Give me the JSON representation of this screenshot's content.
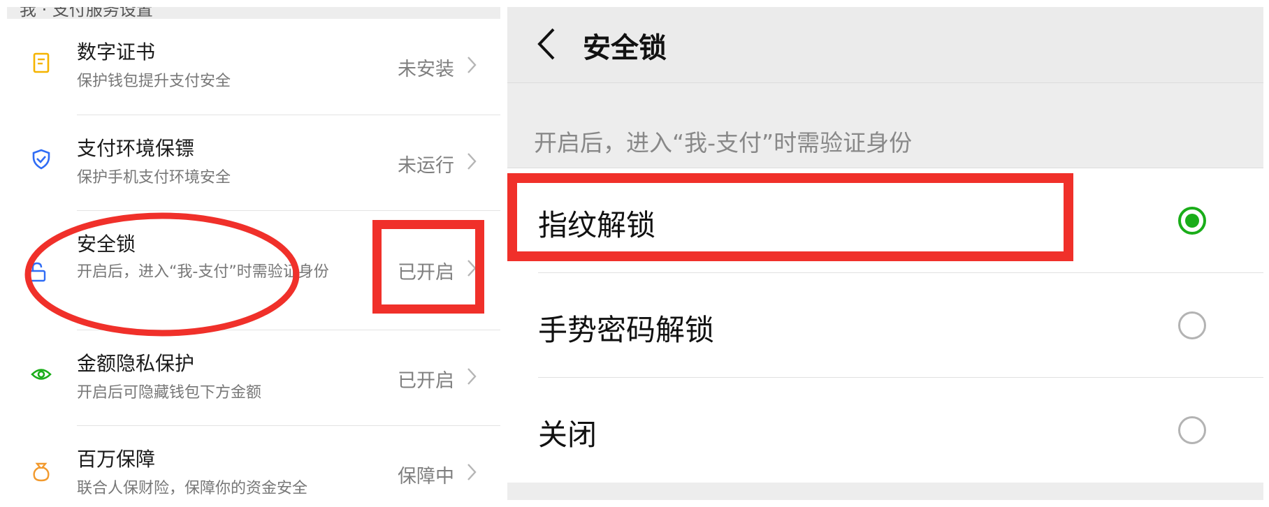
{
  "left_panel": {
    "top_cut_text": "我 · 支付服务设置",
    "items": [
      {
        "icon": "certificate-icon",
        "title": "数字证书",
        "subtitle": "保护钱包提升支付安全",
        "status": "未安装"
      },
      {
        "icon": "shield-check-icon",
        "title": "支付环境保镖",
        "subtitle": "保护手机支付环境安全",
        "status": "未运行"
      },
      {
        "icon": "lock-icon",
        "title": "安全锁",
        "subtitle": "开启后，进入“我-支付”时需验证身份",
        "status": "已开启"
      },
      {
        "icon": "eye-icon",
        "title": "金额隐私保护",
        "subtitle": "开启后可隐藏钱包下方金额",
        "status": "已开启"
      },
      {
        "icon": "money-bag-icon",
        "title": "百万保障",
        "subtitle": "联合人保财险，保障你的资金安全",
        "status": "保障中"
      }
    ]
  },
  "right_panel": {
    "title": "安全锁",
    "description": "开启后，进入“我-支付”时需验证身份",
    "options": [
      {
        "label": "指纹解锁",
        "selected": true
      },
      {
        "label": "手势密码解锁",
        "selected": false
      },
      {
        "label": "关闭",
        "selected": false
      }
    ]
  },
  "colors": {
    "accent_green": "#1aad19",
    "annotation_red": "#f0302a",
    "certificate_icon": "#f5b400",
    "shield_icon": "#2f6cf5",
    "eye_icon": "#1aad19",
    "money_bag_icon": "#f29a2e"
  }
}
